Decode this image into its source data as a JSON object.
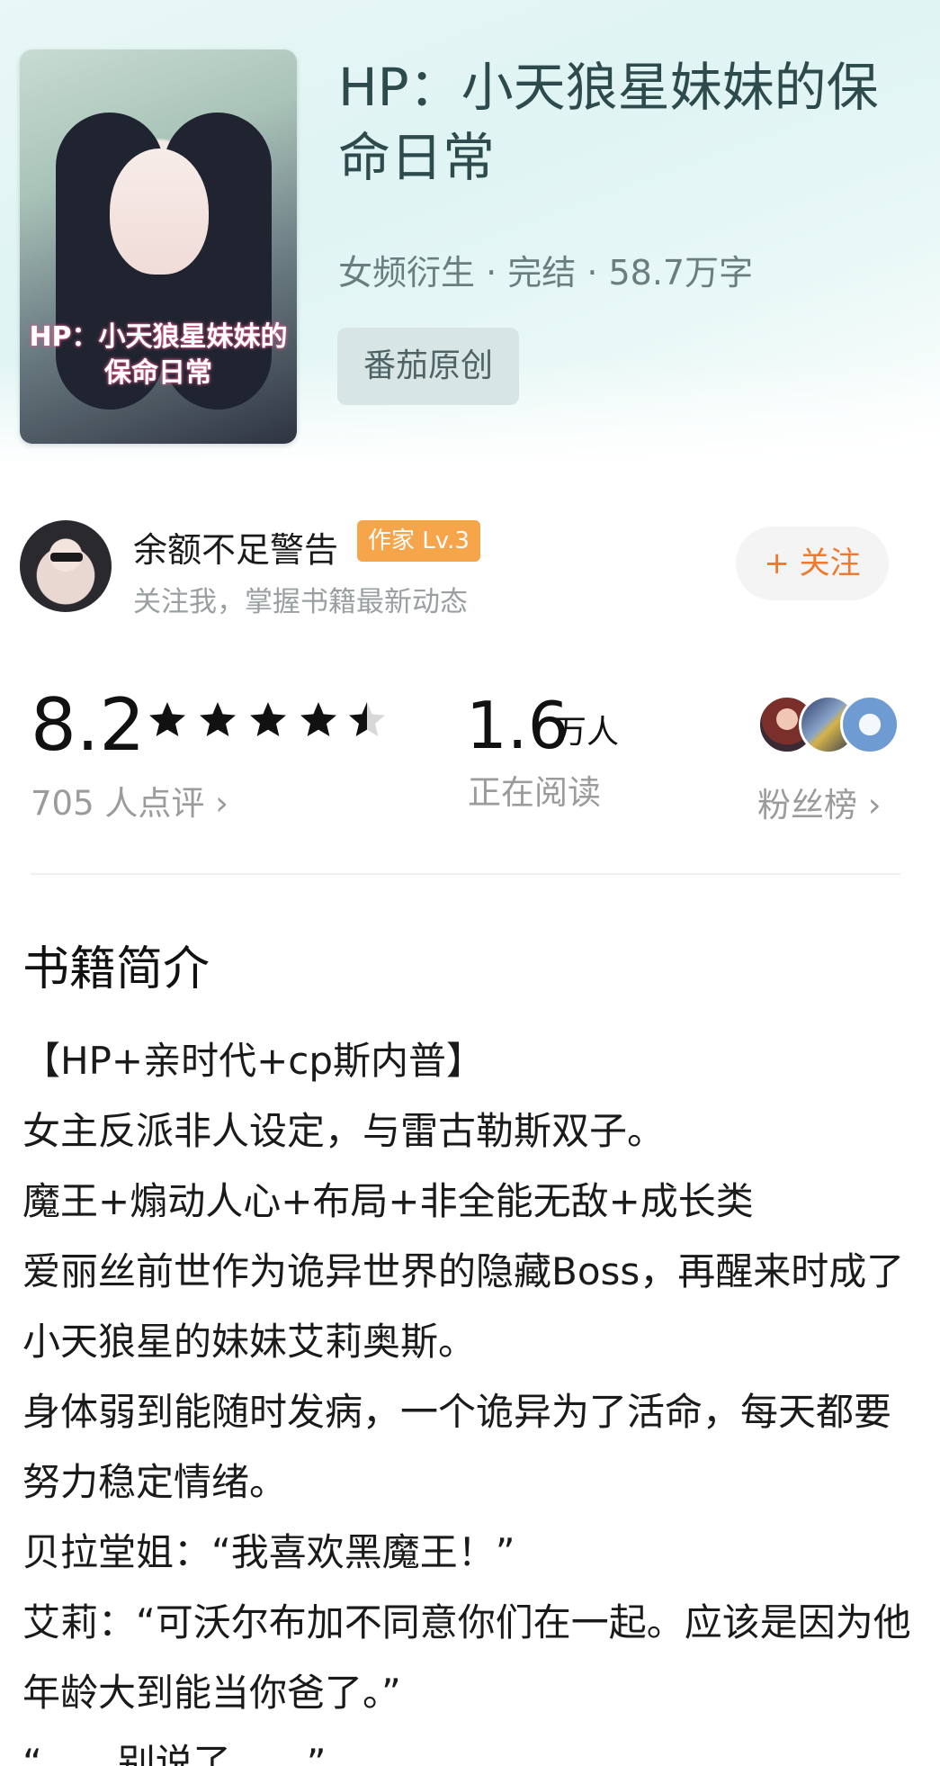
{
  "book": {
    "cover_title": "HP：小天狼星妹妹的保命日常",
    "title": "HP：小天狼星妹妹的保命日常",
    "meta": "女频衍生 · 完结 · 58.7万字",
    "tag": "番茄原创"
  },
  "author": {
    "name": "余额不足警告",
    "level": "作家 Lv.3",
    "subtitle": "关注我，掌握书籍最新动态",
    "follow_label": "+ 关注"
  },
  "stats": {
    "rating": "8.2",
    "stars": 4.5,
    "rating_count_label": "705 人点评 ›",
    "reading_number": "1.6",
    "reading_unit": "万人",
    "reading_label": "正在阅读",
    "fans_label": "粉丝榜 ›"
  },
  "intro": {
    "title": "书籍简介",
    "paragraphs": [
      "【HP+亲时代+cp斯内普】",
      "女主反派非人设定，与雷古勒斯双子。",
      "魔王+煽动人心+布局+非全能无敌+成长类",
      "爱丽丝前世作为诡异世界的隐藏Boss，再醒来时成了小天狼星的妹妹艾莉奥斯。",
      "身体弱到能随时发病，一个诡异为了活命，每天都要努力稳定情绪。",
      "贝拉堂姐：“我喜欢黑魔王！”",
      "艾莉：“可沃尔布加不同意你们在一起。应该是因为他年龄大到能当你爸了。”",
      "“……别说了……”"
    ]
  },
  "icons": {
    "star": "star-icon",
    "chevron": "chevron-right-icon"
  }
}
